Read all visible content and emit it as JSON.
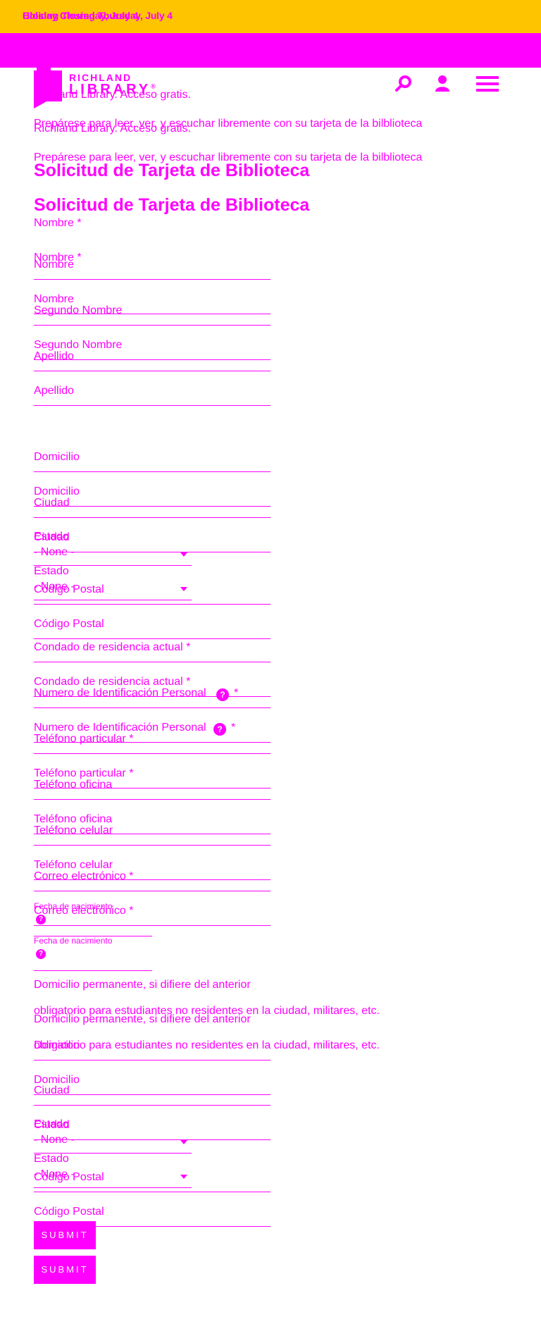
{
  "alert": {
    "text_a": "Closing Thursday, July 4",
    "text_b": "Holiday Closing Thursday, July 4",
    "background": "#ffc400"
  },
  "header": {
    "logo_line1": "RICHLAND",
    "logo_line2": "LIBRARY",
    "logo_mark": "®",
    "icons": [
      "search-icon",
      "user-icon",
      "menu-icon"
    ]
  },
  "intro": {
    "line1": "Richland Library. Acceso gratis.",
    "line2": "Prepárese para leer, ver, y escuchar libremente con su tarjeta de la bilblioteca"
  },
  "form": {
    "title": "Solicitud de Tarjeta de Biblioteca",
    "name_section_label": "Nombre *",
    "first_name": "Nombre",
    "middle_name": "Segundo Nombre",
    "last_name": "Apellido",
    "address": "Domicilio",
    "city": "Ciudad",
    "state": "Estado",
    "state_select": "- None -",
    "zip": "Código Postal",
    "county": "Condado de residencia actual *",
    "pin": "Numero de Identificación Personal",
    "pin_required": "*",
    "home_phone": "Teléfono particular *",
    "work_phone": "Teléfono oficina",
    "cell_phone": "Teléfono celular",
    "email": "Correo electrónico *",
    "dob": "Fecha de nacimiento",
    "help_glyph": "?",
    "permanent_address_title": "Domicilio permanente, si difiere del anterior",
    "permanent_address_note": "obligatorio para estudiantes no residentes en la ciudad, militares, etc.",
    "submit": "SUBMIT"
  },
  "colors": {
    "accent": "#ff00ff",
    "alert": "#ffc400"
  }
}
